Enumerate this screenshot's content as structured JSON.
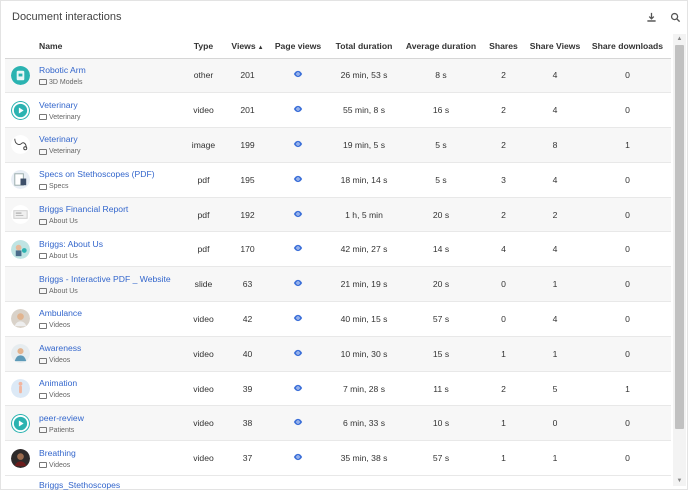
{
  "panel": {
    "title": "Document interactions",
    "download_icon": "download-icon",
    "search_icon": "search-icon"
  },
  "columns": {
    "name": "Name",
    "type": "Type",
    "views": "Views",
    "views_sort": "▲",
    "page_views": "Page views",
    "total_duration": "Total duration",
    "average_duration": "Average duration",
    "shares": "Shares",
    "share_views": "Share Views",
    "share_downloads": "Share downloads"
  },
  "rows": [
    {
      "name": "Robotic Arm",
      "folder": "3D Models",
      "type": "other",
      "views": "201",
      "total": "26 min, 53 s",
      "avg": "8 s",
      "shares": "2",
      "share_views": "4",
      "share_downloads": "0",
      "thumb": "robot-thumbnail"
    },
    {
      "name": "Veterinary",
      "folder": "Veterinary",
      "type": "video",
      "views": "201",
      "total": "55 min, 8 s",
      "avg": "16 s",
      "shares": "2",
      "share_views": "4",
      "share_downloads": "0",
      "thumb": "video-play-thumbnail"
    },
    {
      "name": "Veterinary",
      "folder": "Veterinary",
      "type": "image",
      "views": "199",
      "total": "19 min, 5 s",
      "avg": "5 s",
      "shares": "2",
      "share_views": "8",
      "share_downloads": "1",
      "thumb": "stethoscope-sketch-thumbnail"
    },
    {
      "name": "Specs on Stethoscopes (PDF)",
      "folder": "Specs",
      "type": "pdf",
      "views": "195",
      "total": "18 min, 14 s",
      "avg": "5 s",
      "shares": "3",
      "share_views": "4",
      "share_downloads": "0",
      "thumb": "pdf-page-thumbnail"
    },
    {
      "name": "Briggs Financial Report",
      "folder": "About Us",
      "type": "pdf",
      "views": "192",
      "total": "1 h, 5 min",
      "avg": "20 s",
      "shares": "2",
      "share_views": "2",
      "share_downloads": "0",
      "thumb": "report-thumbnail"
    },
    {
      "name": "Briggs: About Us",
      "folder": "About Us",
      "type": "pdf",
      "views": "170",
      "total": "42 min, 27 s",
      "avg": "14 s",
      "shares": "4",
      "share_views": "4",
      "share_downloads": "0",
      "thumb": "about-thumbnail"
    },
    {
      "name": "Briggs - Interactive PDF _ Website",
      "folder": "About Us",
      "type": "slide",
      "views": "63",
      "total": "21 min, 19 s",
      "avg": "20 s",
      "shares": "0",
      "share_views": "1",
      "share_downloads": "0",
      "thumb": "none"
    },
    {
      "name": "Ambulance",
      "folder": "Videos",
      "type": "video",
      "views": "42",
      "total": "40 min, 15 s",
      "avg": "57 s",
      "shares": "0",
      "share_views": "4",
      "share_downloads": "0",
      "thumb": "person-thumbnail"
    },
    {
      "name": "Awareness",
      "folder": "Videos",
      "type": "video",
      "views": "40",
      "total": "10 min, 30 s",
      "avg": "15 s",
      "shares": "1",
      "share_views": "1",
      "share_downloads": "0",
      "thumb": "doctor-thumbnail"
    },
    {
      "name": "Animation",
      "folder": "Videos",
      "type": "video",
      "views": "39",
      "total": "7 min, 28 s",
      "avg": "11 s",
      "shares": "2",
      "share_views": "5",
      "share_downloads": "1",
      "thumb": "body-thumbnail"
    },
    {
      "name": "peer-review",
      "folder": "Patients",
      "type": "video",
      "views": "38",
      "total": "6 min, 33 s",
      "avg": "10 s",
      "shares": "1",
      "share_views": "0",
      "share_downloads": "0",
      "thumb": "video-play-thumbnail"
    },
    {
      "name": "Breathing",
      "folder": "Videos",
      "type": "video",
      "views": "37",
      "total": "35 min, 38 s",
      "avg": "57 s",
      "shares": "1",
      "share_views": "1",
      "share_downloads": "0",
      "thumb": "dark-person-thumbnail"
    }
  ],
  "peek_row": {
    "name": "Briggs_Stethoscopes"
  },
  "scrollbar": {
    "up": "▲",
    "down": "▼"
  },
  "colors": {
    "link": "#3366cc",
    "accent": "#3b6fd8",
    "teal": "#2bb3b1"
  }
}
